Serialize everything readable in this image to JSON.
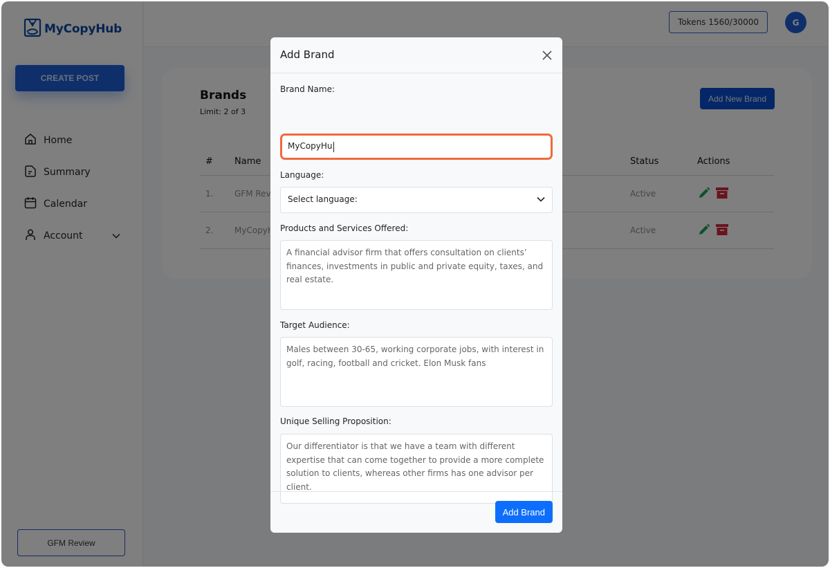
{
  "app": {
    "name": "MyCopyHub"
  },
  "sidebar": {
    "create_post_label": "CREATE POST",
    "items": [
      {
        "label": "Home",
        "icon": "home-icon"
      },
      {
        "label": "Summary",
        "icon": "document-icon"
      },
      {
        "label": "Calendar",
        "icon": "calendar-icon"
      },
      {
        "label": "Account",
        "icon": "user-icon",
        "expandable": true
      }
    ],
    "current_brand_button": "GFM Review"
  },
  "header": {
    "tokens_label": "Tokens 1560/30000",
    "avatar_initial": "G"
  },
  "brands": {
    "title": "Brands",
    "limit": "Limit: 2 of 3",
    "add_new_label": "Add New Brand",
    "columns": [
      "#",
      "Name",
      "Status",
      "Actions"
    ],
    "rows": [
      {
        "num": "1.",
        "name": "GFM Review",
        "status": "Active"
      },
      {
        "num": "2.",
        "name": "MyCopyHub",
        "status": "Active"
      }
    ]
  },
  "modal": {
    "title": "Add Brand",
    "fields": {
      "brand_name": {
        "label": "Brand Name:",
        "value": "MyCopyHu"
      },
      "language": {
        "label": "Language:",
        "selected": "Select language:"
      },
      "products": {
        "label": "Products and Services Offered:",
        "value": "A financial advisor firm that offers consultation on clients’ finances, investments in public and private equity, taxes, and real estate."
      },
      "audience": {
        "label": "Target Audience:",
        "value": "Males between 30-65, working corporate jobs, with interest in golf, racing, football and cricket. Elon Musk fans"
      },
      "usp": {
        "label": "Unique Selling Proposition:",
        "value": "Our differentiator is that we have a team with different expertise that can come together to provide a more complete solution to clients, whereas other firms has one advisor per client."
      }
    },
    "submit_label": "Add Brand"
  },
  "colors": {
    "brand_blue": "#1f5fd6",
    "primary_button": "#0d6efd",
    "focus_ring": "#ef6a3c",
    "edit_green": "#1e9e5a",
    "delete_red": "#d0283c"
  }
}
